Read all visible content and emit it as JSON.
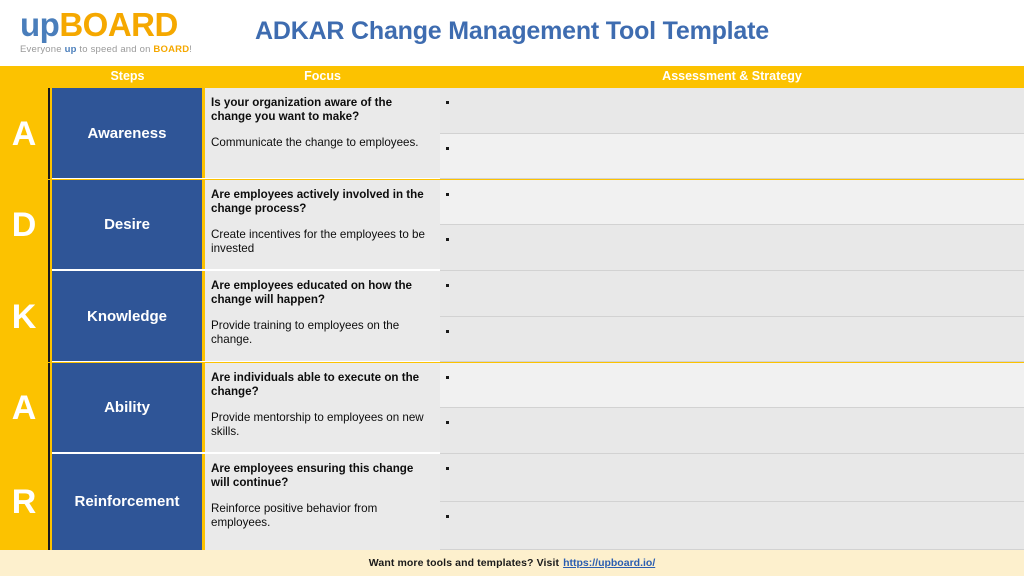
{
  "brand": {
    "logo_prefix": "up",
    "logo_suffix": "BOARD",
    "tagline_part1": "Everyone ",
    "tagline_up": "up",
    "tagline_part2": " to speed and on ",
    "tagline_board": "BOARD",
    "tagline_part3": "!",
    "accent_blue": "#4a7ebb",
    "accent_gold": "#f5a800"
  },
  "header": {
    "title": "ADKAR Change Management Tool Template",
    "title_color": "#3e6cb0"
  },
  "table": {
    "columns": {
      "steps": "Steps",
      "focus": "Focus",
      "assessment": "Assessment & Strategy"
    },
    "header_bg": "#FCC200",
    "step_bg": "#2f5597",
    "rows": [
      {
        "letter": "A",
        "step": "Awareness",
        "question": "Is your organization aware of the change you want to make?",
        "action": "Communicate the change to employees.",
        "assessment": [
          "",
          ""
        ]
      },
      {
        "letter": "D",
        "step": "Desire",
        "question": "Are employees actively involved in the change process?",
        "action": "Create incentives for the employees to be invested",
        "assessment": [
          "",
          ""
        ]
      },
      {
        "letter": "K",
        "step": "Knowledge",
        "question": "Are employees educated on how the change will happen?",
        "action": "Provide training to employees on the change.",
        "assessment": [
          "",
          ""
        ]
      },
      {
        "letter": "A",
        "step": "Ability",
        "question": "Are individuals able to execute on the change?",
        "action": "Provide mentorship to employees on new skills.",
        "assessment": [
          "",
          ""
        ]
      },
      {
        "letter": "R",
        "step": "Reinforcement",
        "question": "Are employees ensuring this change will continue?",
        "action": "Reinforce positive behavior from employees.",
        "assessment": [
          "",
          ""
        ]
      }
    ]
  },
  "footer": {
    "text": "Want more tools and templates? Visit",
    "link": "https://upboard.io/",
    "bg": "#fdf0cd"
  }
}
